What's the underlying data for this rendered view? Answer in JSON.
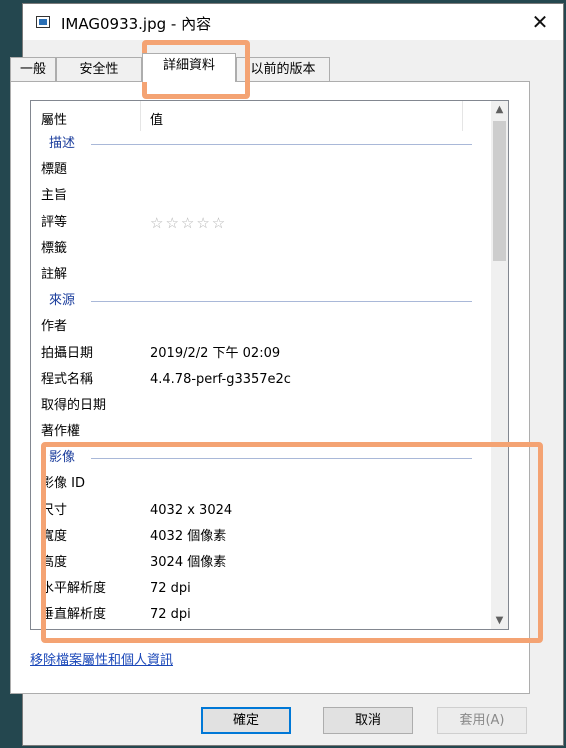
{
  "window": {
    "title": "IMAG0933.jpg - 內容",
    "close_glyph": "✕"
  },
  "tabs": [
    {
      "label": "一般"
    },
    {
      "label": "安全性"
    },
    {
      "label": "詳細資料",
      "active": true
    },
    {
      "label": "以前的版本"
    }
  ],
  "list": {
    "col_property": "屬性",
    "col_value": "值",
    "rows": [
      {
        "type": "group",
        "label": "描述"
      },
      {
        "type": "prop",
        "key": "標題",
        "value": ""
      },
      {
        "type": "prop",
        "key": "主旨",
        "value": ""
      },
      {
        "type": "rating",
        "key": "評等",
        "value": "☆☆☆☆☆"
      },
      {
        "type": "prop",
        "key": "標籤",
        "value": ""
      },
      {
        "type": "prop",
        "key": "註解",
        "value": ""
      },
      {
        "type": "group",
        "label": "來源"
      },
      {
        "type": "prop",
        "key": "作者",
        "value": ""
      },
      {
        "type": "prop",
        "key": "拍攝日期",
        "value": "2019/2/2 下午 02:09"
      },
      {
        "type": "prop",
        "key": "程式名稱",
        "value": "4.4.78-perf-g3357e2c"
      },
      {
        "type": "prop",
        "key": "取得的日期",
        "value": ""
      },
      {
        "type": "prop",
        "key": "著作權",
        "value": ""
      },
      {
        "type": "group",
        "label": "影像"
      },
      {
        "type": "prop",
        "key": "影像 ID",
        "value": ""
      },
      {
        "type": "prop",
        "key": "尺寸",
        "value": "4032 x 3024"
      },
      {
        "type": "prop",
        "key": "寬度",
        "value": "4032 個像素"
      },
      {
        "type": "prop",
        "key": "高度",
        "value": "3024 個像素"
      },
      {
        "type": "prop",
        "key": "水平解析度",
        "value": "72 dpi"
      },
      {
        "type": "prop",
        "key": "垂直解析度",
        "value": "72 dpi"
      }
    ]
  },
  "remove_link": "移除檔案屬性和個人資訊",
  "buttons": {
    "ok": "確定",
    "cancel": "取消",
    "apply": "套用(A)"
  },
  "colors": {
    "highlight": "#f4a373",
    "group_text": "#1a3c9c",
    "link": "#1a47b8",
    "desktop": "#24474f"
  }
}
